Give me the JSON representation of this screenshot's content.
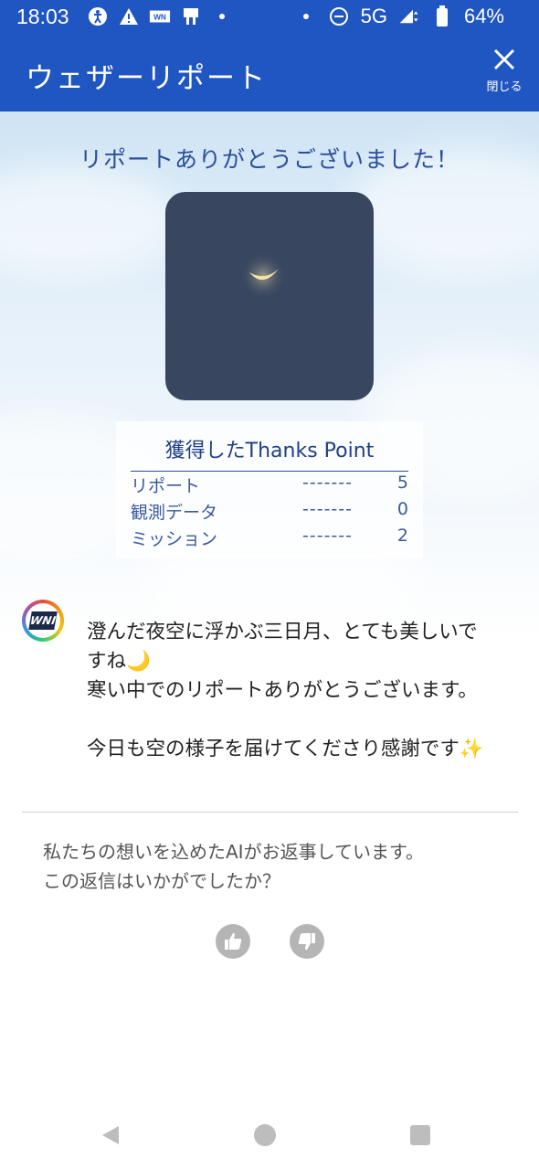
{
  "status_bar": {
    "time": "18:03",
    "network": "5G",
    "battery": "64%",
    "icons": [
      "accessibility-icon",
      "warning-icon",
      "weathernews-icon",
      "cast-icon",
      "dot-icon",
      "dot-icon",
      "dnd-icon",
      "signal-icon",
      "battery-icon"
    ]
  },
  "app_bar": {
    "title": "ウェザーリポート",
    "close_label": "閉じる"
  },
  "thanks": {
    "heading": "リポートありがとうございました！"
  },
  "points": {
    "title": "獲得したThanks Point",
    "dashes": "-------",
    "rows": [
      {
        "label": "リポート",
        "value": "5"
      },
      {
        "label": "観測データ",
        "value": "0"
      },
      {
        "label": "ミッション",
        "value": "2"
      }
    ]
  },
  "message": {
    "logo_text": "WNI",
    "line1": "澄んだ夜空に浮かぶ三日月、とても美しいで",
    "line2": "すね🌙",
    "line3": "寒い中でのリポートありがとうございます。",
    "line4": "今日も空の様子を届けてくださり感謝です✨"
  },
  "ai_note": {
    "line1": "私たちの想いを込めたAIがお返事しています。",
    "line2": "この返信はいかがでしたか？"
  },
  "colors": {
    "primary": "#2056c1",
    "heading": "#2a4f9a",
    "photo_bg": "#38475f"
  }
}
